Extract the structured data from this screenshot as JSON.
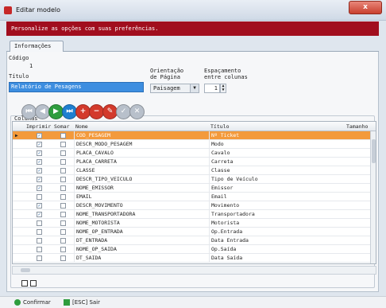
{
  "window": {
    "title": "Editar modelo",
    "close_label": "x"
  },
  "banner": {
    "text": "Personalize as opções com suas preferências."
  },
  "tabs": [
    {
      "label": "Informações"
    }
  ],
  "form": {
    "codigo_label": "Código",
    "codigo_value": "1",
    "titulo_label": "Título",
    "titulo_value": "Relatório de Pesagens",
    "orientacao_label_1": "Orientação",
    "orientacao_label_2": "de Página",
    "orientacao_value": "Paisagem",
    "espacamento_label_1": "Espaçamento",
    "espacamento_label_2": "entre colunas",
    "espacamento_value": "1"
  },
  "colunas": {
    "label": "Colunas",
    "nav_buttons": [
      {
        "name": "first-icon",
        "glyph": "⏮",
        "color": "#b8c0cb"
      },
      {
        "name": "prev-icon",
        "glyph": "◀",
        "color": "#b8c0cb"
      },
      {
        "name": "next-icon",
        "glyph": "▶",
        "color": "#2e9d3e"
      },
      {
        "name": "last-icon",
        "glyph": "⏭",
        "color": "#1e7fd0"
      },
      {
        "name": "add-icon",
        "glyph": "+",
        "color": "#d33a2c"
      },
      {
        "name": "remove-icon",
        "glyph": "−",
        "color": "#d33a2c"
      },
      {
        "name": "edit-icon",
        "glyph": "✎",
        "color": "#d33a2c"
      },
      {
        "name": "confirm-icon",
        "glyph": "✓",
        "color": "#b8c0cb"
      },
      {
        "name": "cancel-icon",
        "glyph": "✕",
        "color": "#b8c0cb"
      }
    ]
  },
  "grid": {
    "headers": {
      "imprimir": "Imprimir",
      "somar": "Somar",
      "nome": "Nome",
      "titulo": "Título",
      "tamanho": "Tamanho"
    },
    "rows": [
      {
        "imprimir": true,
        "somar": false,
        "nome": "COD_PESAGEM",
        "titulo": "Nº Ticket",
        "selected": true
      },
      {
        "imprimir": true,
        "somar": false,
        "nome": "DESCR_MODO_PESAGEM",
        "titulo": "Modo"
      },
      {
        "imprimir": true,
        "somar": false,
        "nome": "PLACA_CAVALO",
        "titulo": "Cavalo"
      },
      {
        "imprimir": true,
        "somar": false,
        "nome": "PLACA_CARRETA",
        "titulo": "Carreta"
      },
      {
        "imprimir": true,
        "somar": false,
        "nome": "CLASSE",
        "titulo": "Classe"
      },
      {
        "imprimir": true,
        "somar": false,
        "nome": "DESCR_TIPO_VEICULO",
        "titulo": "Tipo de Veículo"
      },
      {
        "imprimir": true,
        "somar": false,
        "nome": "NOME_EMISSOR",
        "titulo": "Emissor"
      },
      {
        "imprimir": false,
        "somar": false,
        "nome": "EMAIL",
        "titulo": "Email"
      },
      {
        "imprimir": true,
        "somar": false,
        "nome": "DESCR_MOVIMENTO",
        "titulo": "Movimento"
      },
      {
        "imprimir": true,
        "somar": false,
        "nome": "NOME_TRANSPORTADORA",
        "titulo": "Transportadora"
      },
      {
        "imprimir": false,
        "somar": false,
        "nome": "NOME_MOTORISTA",
        "titulo": "Motorista"
      },
      {
        "imprimir": false,
        "somar": false,
        "nome": "NOME_OP_ENTRADA",
        "titulo": "Op.Entrada"
      },
      {
        "imprimir": false,
        "somar": false,
        "nome": "DT_ENTRADA",
        "titulo": "Data Entrada"
      },
      {
        "imprimir": false,
        "somar": false,
        "nome": "NOME_OP_SAIDA",
        "titulo": "Op.Saída"
      },
      {
        "imprimir": false,
        "somar": false,
        "nome": "DT_SAIDA",
        "titulo": "Data Saída"
      }
    ]
  },
  "footer": {
    "confirm_label": "Confirmar",
    "exit_label": "[ESC] Sair"
  }
}
